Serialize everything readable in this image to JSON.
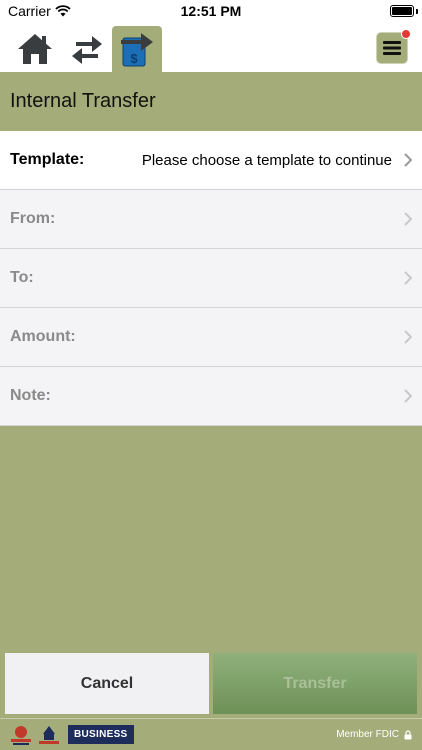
{
  "status": {
    "carrier": "Carrier",
    "time": "12:51 PM",
    "battery_level": 1.0
  },
  "nav": {
    "tabs": [
      {
        "name": "home",
        "icon": "home-icon",
        "active": false
      },
      {
        "name": "transfers",
        "icon": "transfer-arrows-icon",
        "active": false
      },
      {
        "name": "internal-transfer",
        "icon": "internal-transfer-icon",
        "active": true
      }
    ],
    "menu_icon": "hamburger-menu-icon",
    "has_notification": true
  },
  "page": {
    "title": "Internal Transfer"
  },
  "form": {
    "template_label": "Template:",
    "template_value": "Please choose a template to continue",
    "from_label": "From:",
    "to_label": "To:",
    "amount_label": "Amount:",
    "note_label": "Note:"
  },
  "actions": {
    "cancel_label": "Cancel",
    "transfer_label": "Transfer"
  },
  "footer": {
    "badge": "BUSINESS",
    "fdic": "Member FDIC"
  },
  "colors": {
    "accent": "#a4ad79",
    "icon_dark": "#3a3d40",
    "icon_blue": "#1c6fb7",
    "badge_navy": "#1d2c5a",
    "transfer_green": "#7da066"
  }
}
